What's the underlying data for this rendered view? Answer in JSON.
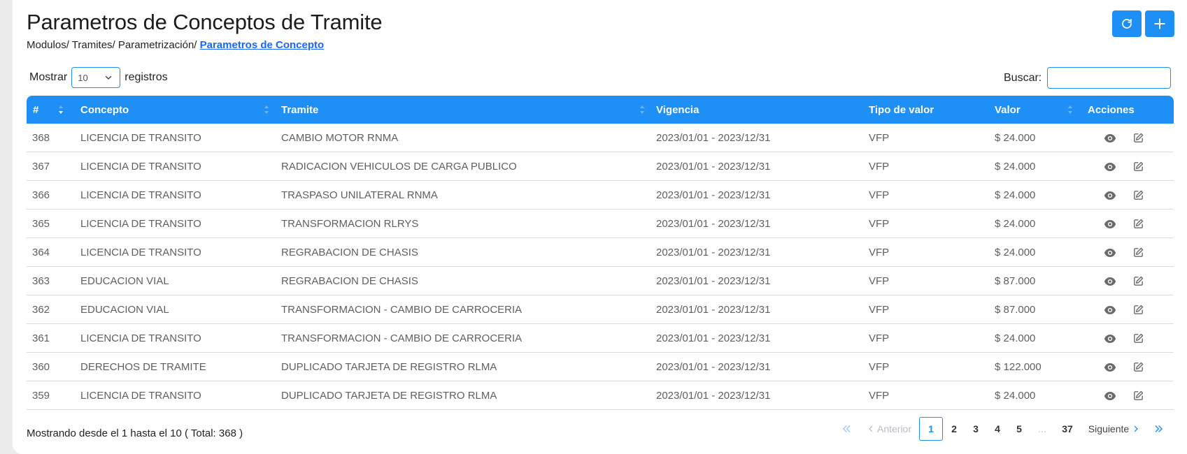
{
  "page": {
    "title": "Parametros de Conceptos de Tramite",
    "breadcrumb": [
      "Modulos/",
      "Tramites/",
      "Parametrización/"
    ],
    "breadcrumb_active": "Parametros de Concepto"
  },
  "toolbar": {
    "refresh_icon": "refresh-icon",
    "add_icon": "plus-icon",
    "accent": "#1e8ff5"
  },
  "length": {
    "prefix": "Mostrar",
    "value": "10",
    "suffix": "registros"
  },
  "search": {
    "label": "Buscar:",
    "value": ""
  },
  "table": {
    "headers": [
      "#",
      "Concepto",
      "Tramite",
      "Vigencia",
      "Tipo de valor",
      "Valor",
      "Acciones"
    ],
    "rows": [
      {
        "id": "368",
        "concepto": "LICENCIA DE TRANSITO",
        "tramite": "CAMBIO MOTOR RNMA",
        "vigencia": "2023/01/01 - 2023/12/31",
        "tipo": "VFP",
        "valor": "$ 24.000"
      },
      {
        "id": "367",
        "concepto": "LICENCIA DE TRANSITO",
        "tramite": "RADICACION VEHICULOS DE CARGA PUBLICO",
        "vigencia": "2023/01/01 - 2023/12/31",
        "tipo": "VFP",
        "valor": "$ 24.000"
      },
      {
        "id": "366",
        "concepto": "LICENCIA DE TRANSITO",
        "tramite": "TRASPASO UNILATERAL RNMA",
        "vigencia": "2023/01/01 - 2023/12/31",
        "tipo": "VFP",
        "valor": "$ 24.000"
      },
      {
        "id": "365",
        "concepto": "LICENCIA DE TRANSITO",
        "tramite": "TRANSFORMACION RLRYS",
        "vigencia": "2023/01/01 - 2023/12/31",
        "tipo": "VFP",
        "valor": "$ 24.000"
      },
      {
        "id": "364",
        "concepto": "LICENCIA DE TRANSITO",
        "tramite": "REGRABACION DE CHASIS",
        "vigencia": "2023/01/01 - 2023/12/31",
        "tipo": "VFP",
        "valor": "$ 24.000"
      },
      {
        "id": "363",
        "concepto": "EDUCACION VIAL",
        "tramite": "REGRABACION DE CHASIS",
        "vigencia": "2023/01/01 - 2023/12/31",
        "tipo": "VFP",
        "valor": "$ 87.000"
      },
      {
        "id": "362",
        "concepto": "EDUCACION VIAL",
        "tramite": "TRANSFORMACION - CAMBIO DE CARROCERIA",
        "vigencia": "2023/01/01 - 2023/12/31",
        "tipo": "VFP",
        "valor": "$ 87.000"
      },
      {
        "id": "361",
        "concepto": "LICENCIA DE TRANSITO",
        "tramite": "TRANSFORMACION - CAMBIO DE CARROCERIA",
        "vigencia": "2023/01/01 - 2023/12/31",
        "tipo": "VFP",
        "valor": "$ 24.000"
      },
      {
        "id": "360",
        "concepto": "DERECHOS DE TRAMITE",
        "tramite": "DUPLICADO TARJETA DE REGISTRO RLMA",
        "vigencia": "2023/01/01 - 2023/12/31",
        "tipo": "VFP",
        "valor": "$ 122.000"
      },
      {
        "id": "359",
        "concepto": "LICENCIA DE TRANSITO",
        "tramite": "DUPLICADO TARJETA DE REGISTRO RLMA",
        "vigencia": "2023/01/01 - 2023/12/31",
        "tipo": "VFP",
        "valor": "$ 24.000"
      }
    ]
  },
  "footer": {
    "info": "Mostrando desde el 1 hasta el 10 ( Total: 368 )",
    "prev": "Anterior",
    "next": "Siguiente",
    "pages": [
      "1",
      "2",
      "3",
      "4",
      "5",
      "...",
      "37"
    ],
    "current": "1"
  }
}
